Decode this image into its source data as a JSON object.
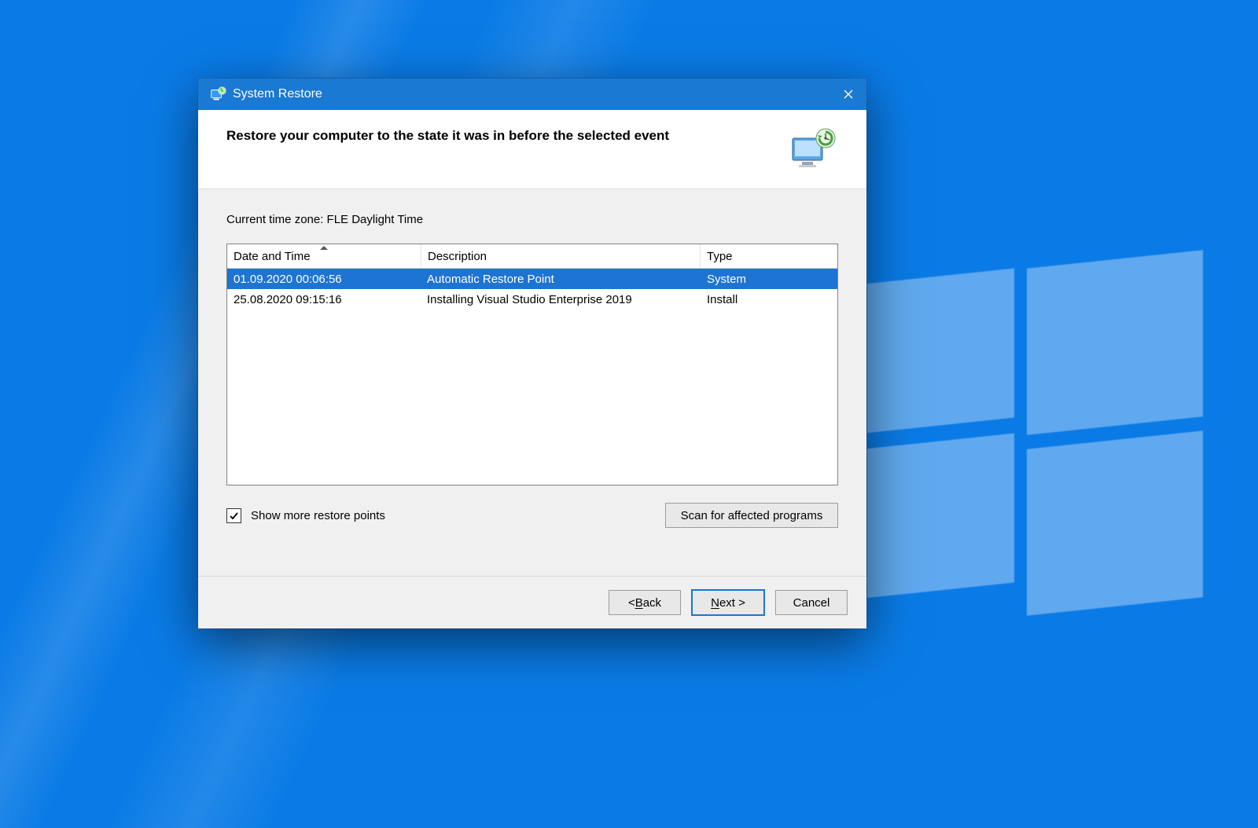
{
  "window": {
    "title": "System Restore",
    "heading": "Restore your computer to the state it was in before the selected event",
    "timezone_line": "Current time zone: FLE Daylight Time"
  },
  "columns": {
    "date": "Date and Time",
    "desc": "Description",
    "type": "Type"
  },
  "rows": [
    {
      "date": "01.09.2020 00:06:56",
      "desc": "Automatic Restore Point",
      "type": "System",
      "selected": true
    },
    {
      "date": "25.08.2020 09:15:16",
      "desc": "Installing Visual Studio Enterprise 2019",
      "type": "Install",
      "selected": false
    }
  ],
  "show_more": {
    "checked": true,
    "label": "Show more restore points"
  },
  "buttons": {
    "scan": "Scan for affected programs",
    "back_prefix": "< ",
    "back_ul": "B",
    "back_suffix": "ack",
    "next_ul": "N",
    "next_suffix": "ext >",
    "cancel": "Cancel"
  }
}
